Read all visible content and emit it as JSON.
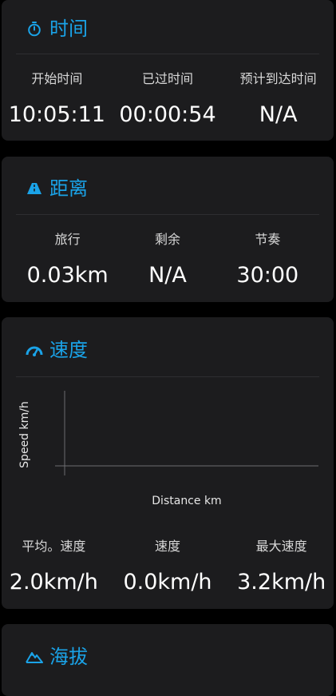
{
  "time_card": {
    "title": "时间",
    "icon": "stopwatch-icon",
    "stats": [
      {
        "label": "开始时间",
        "value": "10:05:11"
      },
      {
        "label": "已过时间",
        "value": "00:00:54"
      },
      {
        "label": "预计到达时间",
        "value": "N/A"
      }
    ]
  },
  "distance_card": {
    "title": "距离",
    "icon": "road-icon",
    "stats": [
      {
        "label": "旅行",
        "value": "0.03km"
      },
      {
        "label": "剩余",
        "value": "N/A"
      },
      {
        "label": "节奏",
        "value": "30:00"
      }
    ]
  },
  "speed_card": {
    "title": "速度",
    "icon": "speedometer-icon",
    "chart": {
      "ylabel": "Speed km/h",
      "xlabel": "Distance km"
    },
    "stats": [
      {
        "label": "平均。速度",
        "value": "2.0km/h"
      },
      {
        "label": "速度",
        "value": "0.0km/h"
      },
      {
        "label": "最大速度",
        "value": "3.2km/h"
      }
    ]
  },
  "altitude_card": {
    "title": "海拔",
    "icon": "mountain-icon"
  },
  "colors": {
    "accent": "#1aa3e8",
    "card_bg": "#1c1c1e",
    "page_bg": "#000000"
  }
}
